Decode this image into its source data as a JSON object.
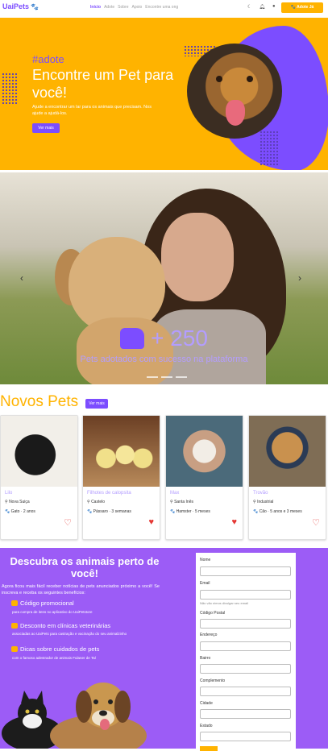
{
  "nav": {
    "brand": "UaiPets",
    "links": [
      {
        "label": "Início",
        "active": true
      },
      {
        "label": "Adote",
        "active": false
      },
      {
        "label": "Sobre",
        "active": false
      },
      {
        "label": "Apoio",
        "active": false
      },
      {
        "label": "Encontre uma ong",
        "active": false
      }
    ],
    "icons": [
      "moon-icon",
      "bell-icon",
      "user-icon"
    ],
    "adopt_button": "Adote Já"
  },
  "hero": {
    "hashtag": "#adote",
    "title": "Encontre um Pet para você!",
    "text": "Ajude a encontrar um lar para os animais que precisam. Nos ajude a ajudá-los.",
    "more_button": "Ver mais"
  },
  "carousel": {
    "count": "+ 250",
    "subtitle": "Pets adotados com sucesso na plataforma",
    "prev_icon": "chevron-left-icon",
    "next_icon": "chevron-right-icon"
  },
  "novos": {
    "title": "Novos Pets",
    "more_button": "Ver mais",
    "pets": [
      {
        "name": "Lilo",
        "location": "Nova Suiça",
        "info": "Gato · 2 anos",
        "favorited": false
      },
      {
        "name": "Filhotes de calopsita",
        "location": "Castelo",
        "info": "Pássaro · 3 semanas",
        "favorited": true
      },
      {
        "name": "Max",
        "location": "Santa Inês",
        "info": "Hamster · 5 meses",
        "favorited": true
      },
      {
        "name": "Trovão",
        "location": "Industrial",
        "info": "Cão · 5 anos e 3 meses",
        "favorited": false
      }
    ]
  },
  "cta": {
    "title": "Descubra os animais perto de você!",
    "intro": "Agora ficou mais fácil receber notícias de pets anunciados próximo a você! Se inscreva e receba os seguintes benefícios:",
    "benefits": [
      {
        "title": "Código promocional",
        "detail": "para compra de itens no aplicativo do UaiPetstore"
      },
      {
        "title": "Desconto em clínicas veterinárias",
        "detail": "associadas ao UaiPets para castração e vacinação do seu animalzinho"
      },
      {
        "title": "Dicas sobre cuidados de pets",
        "detail": "com o famoso adestrador de animais Fulaner de Tal"
      }
    ]
  },
  "form": {
    "fields": [
      {
        "label": "Nome",
        "hint": ""
      },
      {
        "label": "Email",
        "hint": "Não vão nimos divulgar seu email"
      },
      {
        "label": "Código Postal",
        "hint": ""
      },
      {
        "label": "Endereço",
        "hint": ""
      },
      {
        "label": "Bairro",
        "hint": ""
      },
      {
        "label": "Complemento",
        "hint": ""
      },
      {
        "label": "Cidade",
        "hint": ""
      },
      {
        "label": "Estado",
        "hint": ""
      }
    ]
  },
  "colors": {
    "primary": "#7c4dff",
    "accent": "#ffb300",
    "cta_bg": "#9c5cf6",
    "heart": "#e53935"
  }
}
